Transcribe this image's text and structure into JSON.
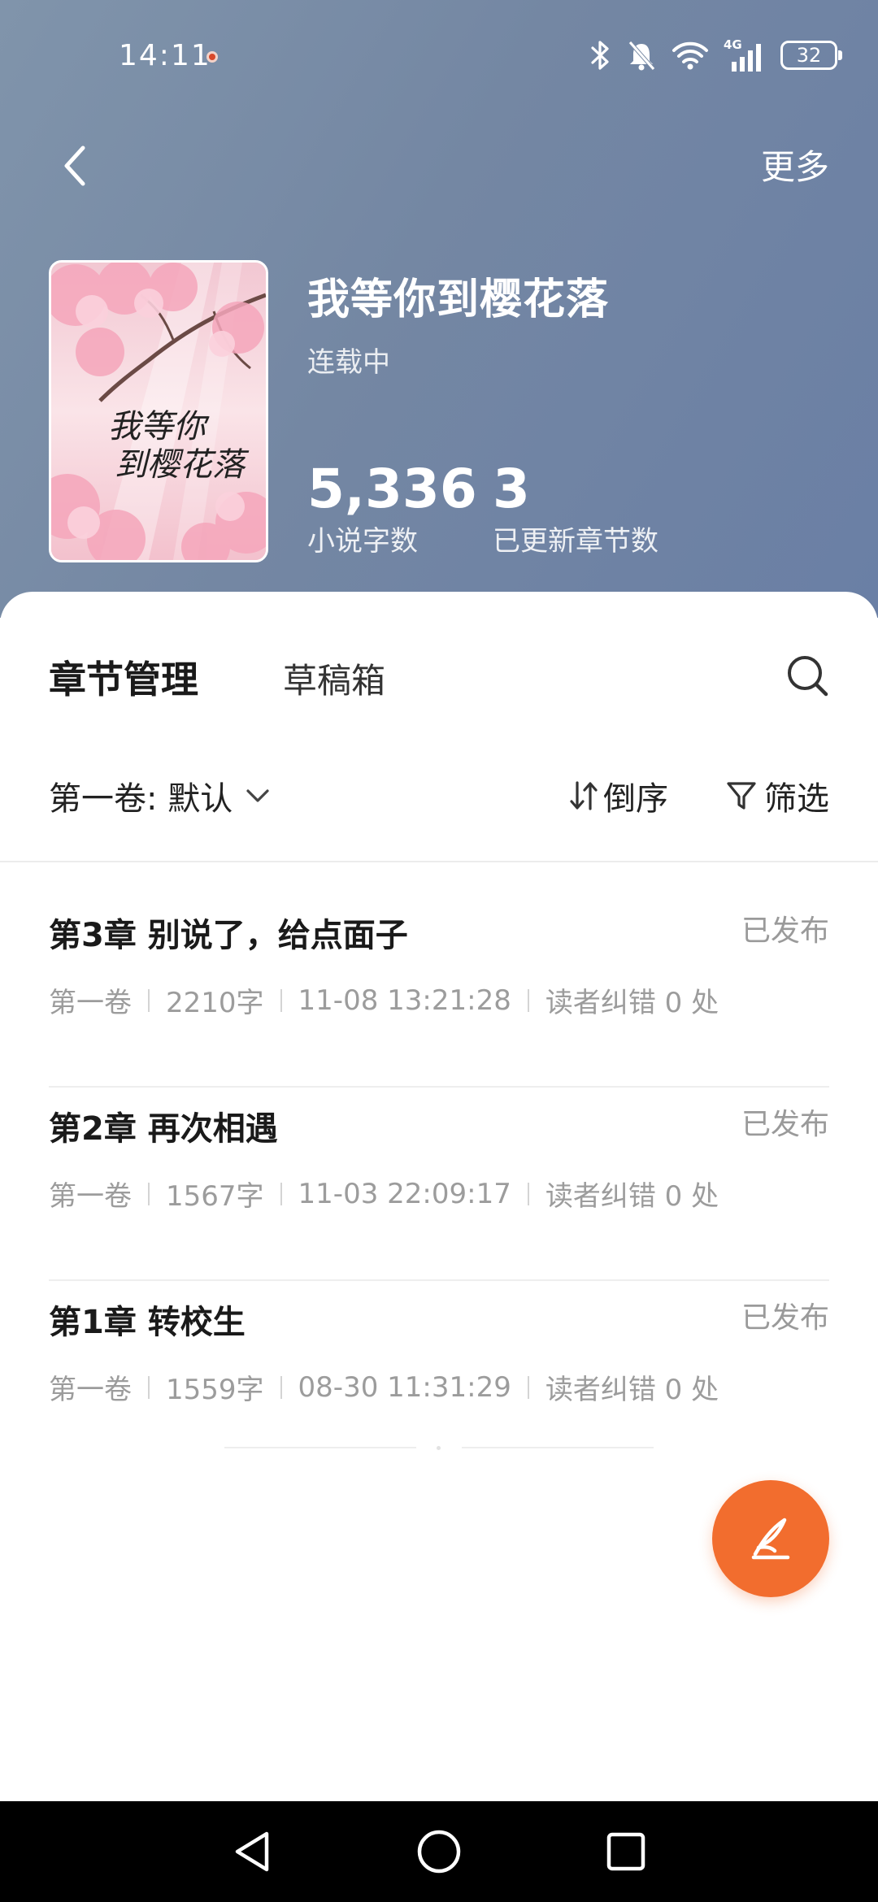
{
  "status_bar": {
    "time": "14:11",
    "battery": "32",
    "network": "4G"
  },
  "header": {
    "more_label": "更多"
  },
  "book": {
    "cover_title": "我等你到樱花落",
    "title": "我等你到樱花落",
    "status": "连载中",
    "word_count": "5,336",
    "word_count_label": "小说字数",
    "chapters_count": "3",
    "chapters_count_label": "已更新章节数"
  },
  "tabs": {
    "active": "章节管理",
    "drafts": "草稿箱"
  },
  "filters": {
    "volume": "第一卷: 默认",
    "sort_label": "倒序",
    "filter_label": "筛选"
  },
  "chapters": [
    {
      "title": "第3章 别说了，给点面子",
      "state": "已发布",
      "volume": "第一卷",
      "words": "2210字",
      "time": "11-08 13:21:28",
      "corrections": "读者纠错 0 处"
    },
    {
      "title": "第2章 再次相遇",
      "state": "已发布",
      "volume": "第一卷",
      "words": "1567字",
      "time": "11-03 22:09:17",
      "corrections": "读者纠错 0 处"
    },
    {
      "title": "第1章 转校生",
      "state": "已发布",
      "volume": "第一卷",
      "words": "1559字",
      "time": "08-30 11:31:29",
      "corrections": "读者纠错 0 处"
    }
  ],
  "icons": {
    "back": "back-arrow-icon",
    "search": "search-icon",
    "sort": "sort-icon",
    "filter": "filter-funnel-icon",
    "write": "quill-icon"
  },
  "colors": {
    "accent": "#f26d2e",
    "hero_start": "#8094ab",
    "hero_end": "#6a7fa5"
  }
}
